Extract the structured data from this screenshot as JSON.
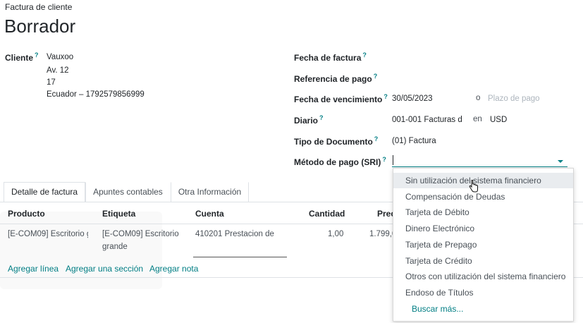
{
  "breadcrumb": "Factura de cliente",
  "title": "Borrador",
  "customer": {
    "label": "Cliente",
    "name": "Vauxoo",
    "address1": "Av. 12",
    "address2": "17",
    "country_vat": "Ecuador – 1792579856999"
  },
  "fields": {
    "invoice_date_label": "Fecha de factura",
    "payment_ref_label": "Referencia de pago",
    "due_date_label": "Fecha de vencimiento",
    "due_date_value": "30/05/2023",
    "or_text": "o",
    "payment_term_placeholder": "Plazo de pago",
    "journal_label": "Diario",
    "journal_value": "001-001 Facturas d",
    "in_text": "en",
    "currency_value": "USD",
    "doc_type_label": "Tipo de Documento",
    "doc_type_value": "(01) Factura",
    "payment_method_label": "Método de pago (SRI)"
  },
  "tabs": [
    "Detalle de factura",
    "Apuntes contables",
    "Otra Información"
  ],
  "table": {
    "headers": [
      "Producto",
      "Etiqueta",
      "Cuenta",
      "Cantidad",
      "Prec"
    ],
    "row": {
      "product": "[E-COM09] Escritorio g",
      "label_line1": "[E-COM09] Escritorio",
      "label_line2": "grande",
      "account": "410201 Prestacion de",
      "quantity": "1,00",
      "price": "1.799,0"
    },
    "actions": [
      "Agregar línea",
      "Agregar una sección",
      "Agregar nota"
    ]
  },
  "dropdown": {
    "options": [
      "Sin utilización del sistema financiero",
      "Compensación de Deudas",
      "Tarjeta de Débito",
      "Dinero Electrónico",
      "Tarjeta de Prepago",
      "Tarjeta de Crédito",
      "Otros con utilización del sistema financiero",
      "Endoso de Títulos"
    ],
    "search_more": "Buscar más...",
    "highlighted_index": 0
  },
  "colors": {
    "accent": "#017e84",
    "border": "#dee2e6"
  }
}
